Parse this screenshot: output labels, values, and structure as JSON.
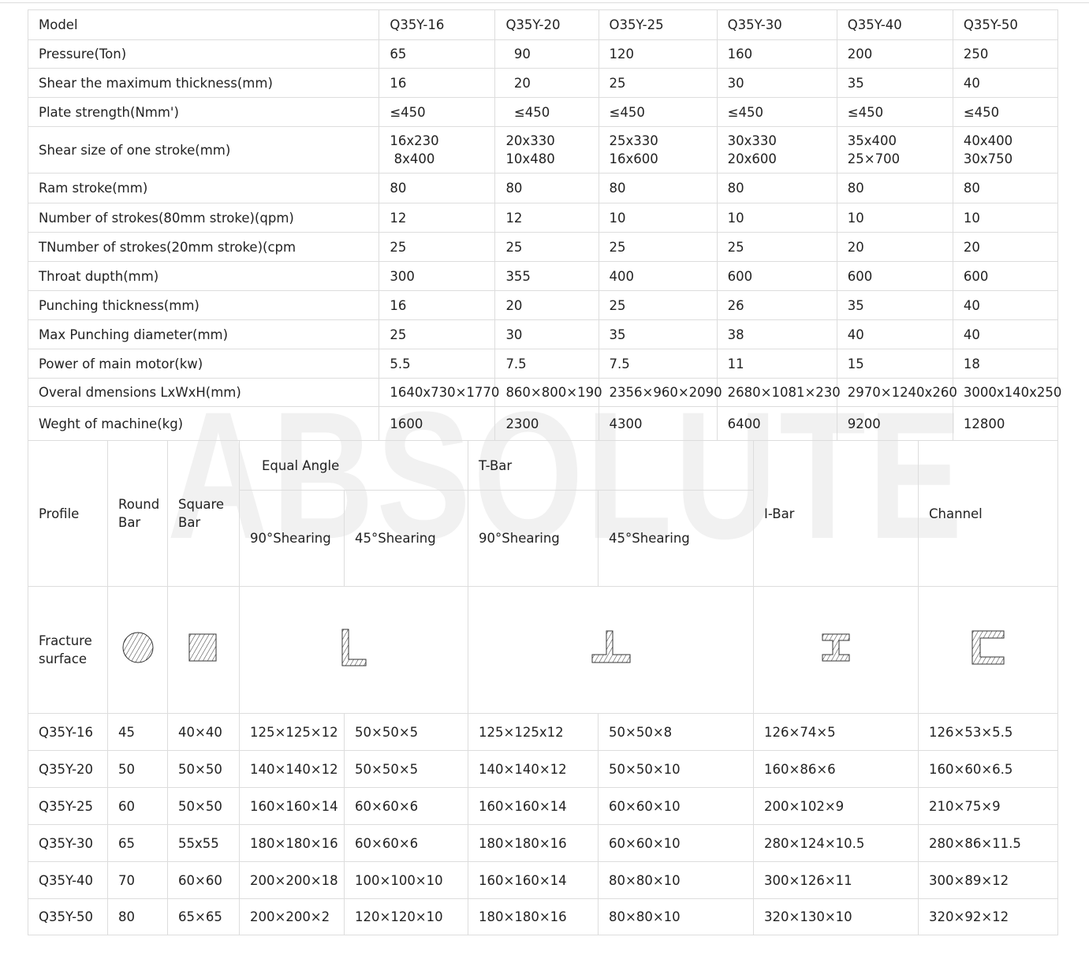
{
  "watermark": "ABSOLUTE",
  "specs": {
    "rows": [
      [
        "Model",
        "Q35Y-16",
        "Q35Y-20",
        "O35Y-25",
        "Q35Y-30",
        "Q35Y-40",
        "Q35Y-50"
      ],
      [
        "Pressure(Ton)",
        "65",
        "  90",
        "120",
        "160",
        "200",
        "250"
      ],
      [
        "Shear the maximum thickness(mm)",
        "16",
        "  20",
        "25",
        "30",
        "35",
        "40"
      ],
      [
        "Plate strength(Nmm')",
        "≤450",
        "  ≤450",
        "≤450",
        "≤450",
        "≤450",
        "≤450"
      ],
      [
        "Shear size of one stroke(mm)",
        "16x230\n 8x400",
        "20x330\n10x480",
        "25x330\n16x600",
        "30x330\n20x600",
        "35x400\n25×700",
        "40x400\n30x750"
      ],
      [
        "Ram stroke(mm)",
        "80",
        "80",
        "80",
        "80",
        "80",
        "80"
      ],
      [
        "Number of strokes(80mm stroke)(qpm)",
        "12",
        "12",
        "10",
        "10",
        "10",
        "10"
      ],
      [
        "TNumber of strokes(20mm stroke)(cpm",
        "25",
        "25",
        "25",
        "25",
        "20",
        "20"
      ],
      [
        "Throat dupth(mm)",
        "300",
        "355",
        "400",
        "600",
        "600",
        "600"
      ],
      [
        "Punching thickness(mm)",
        "16",
        "20",
        "25",
        "26",
        "35",
        "40"
      ],
      [
        "Max Punching diameter(mm)",
        "25",
        "30",
        "35",
        "38",
        "40",
        "40"
      ],
      [
        "Power of main motor(kw)",
        "5.5",
        "7.5",
        "7.5",
        "11",
        "15",
        "18"
      ],
      [
        "Overal dmensions LxWxH(mm)",
        "1640x730×1770",
        "860×800×190",
        "2356×960×2090",
        "2680×1081×230",
        "2970×1240x260",
        "3000x140x250"
      ],
      [
        "Weght of machine(kg)",
        "1600",
        "2300",
        "4300",
        "6400",
        "9200",
        "12800"
      ]
    ]
  },
  "profile": {
    "header": {
      "profile": "Profile",
      "round_bar": "Round\nBar",
      "square_bar": "Square\nBar",
      "equal_angle": "Equal Angle",
      "t_bar": "T-Bar",
      "shear90": "90°Shearing",
      "shear45": "45°Shearing",
      "i_bar": "I-Bar",
      "channel": "Channel"
    },
    "fracture_label": "Fracture\nsurface",
    "icons": [
      "round-section-icon",
      "square-section-icon",
      "angle-section-icon",
      "t-bar-section-icon",
      "i-bar-section-icon",
      "channel-section-icon"
    ],
    "rows": [
      [
        "Q35Y-16",
        "45",
        "40×40",
        "125×125×12",
        "50×50×5",
        "125×125x12",
        "50×50×8",
        "126×74×5",
        "126×53×5.5"
      ],
      [
        "Q35Y-20",
        "50",
        "50×50",
        "140×140×12",
        "50×50×5",
        "140×140×12",
        "50×50×10",
        "160×86×6",
        "160×60×6.5"
      ],
      [
        "Q35Y-25",
        "60",
        "50×50",
        "160×160×14",
        "60×60×6",
        "160×160×14",
        "60×60×10",
        "200×102×9",
        "210×75×9"
      ],
      [
        "Q35Y-30",
        "65",
        "55x55",
        "180×180×16",
        "60×60×6",
        "180×180×16",
        "60×60×10",
        "280×124×10.5",
        "280×86×11.5"
      ],
      [
        "Q35Y-40",
        "70",
        "60×60",
        "200×200×18",
        "100×100×10",
        "160×160×14",
        "80×80×10",
        "300×126×11",
        "300×89×12"
      ],
      [
        "Q35Y-50",
        "80",
        "65×65",
        "200×200×2",
        "120×120×10",
        "180×180×16",
        "80×80×10",
        "320×130×10",
        "320×92×12"
      ]
    ]
  }
}
